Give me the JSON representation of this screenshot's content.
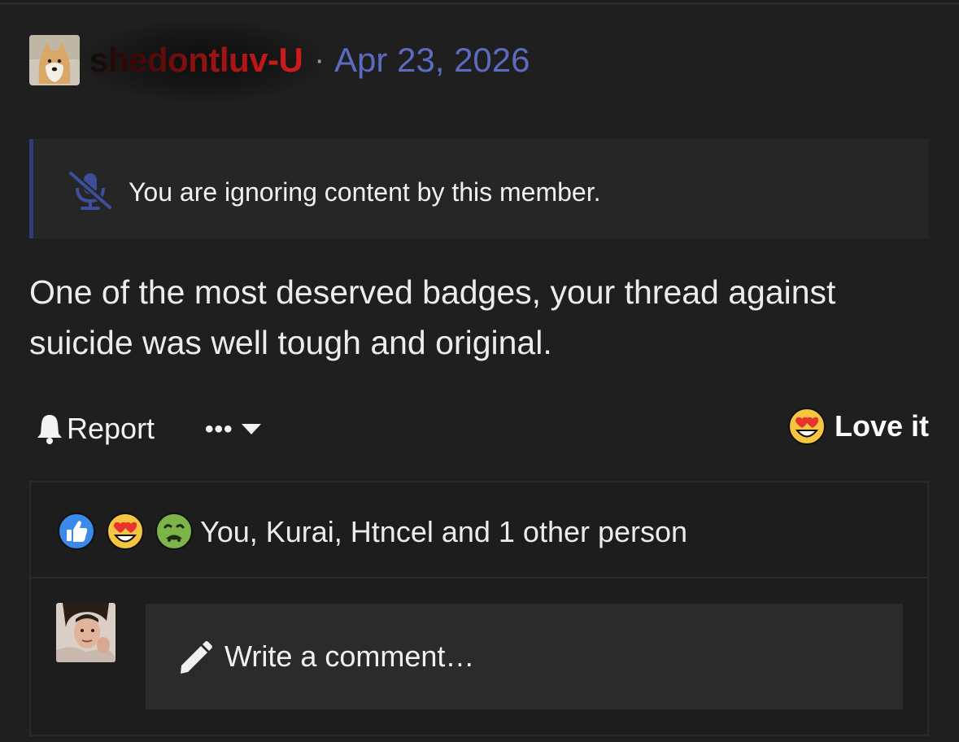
{
  "post": {
    "username": "shedontluv-U",
    "separator": "·",
    "date": "Apr 23, 2026",
    "ignore_notice": "You are ignoring content by this member.",
    "body": "One of the most deserved badges, your thread against suicide was well tough and original."
  },
  "actions": {
    "report_label": "Report",
    "more_label": "•••",
    "reaction_label": "Love it"
  },
  "reactions": {
    "icons": [
      "like-icon",
      "heart-eyes-icon",
      "nauseated-icon"
    ],
    "summary": "You, Kurai, Htncel and 1 other person"
  },
  "comment": {
    "placeholder": "Write a comment…"
  },
  "colors": {
    "background": "#1f1f1f",
    "date": "#5c6bbf",
    "username_gradient_end": "#d01a1a",
    "notice_accent": "#2f3c7a"
  }
}
